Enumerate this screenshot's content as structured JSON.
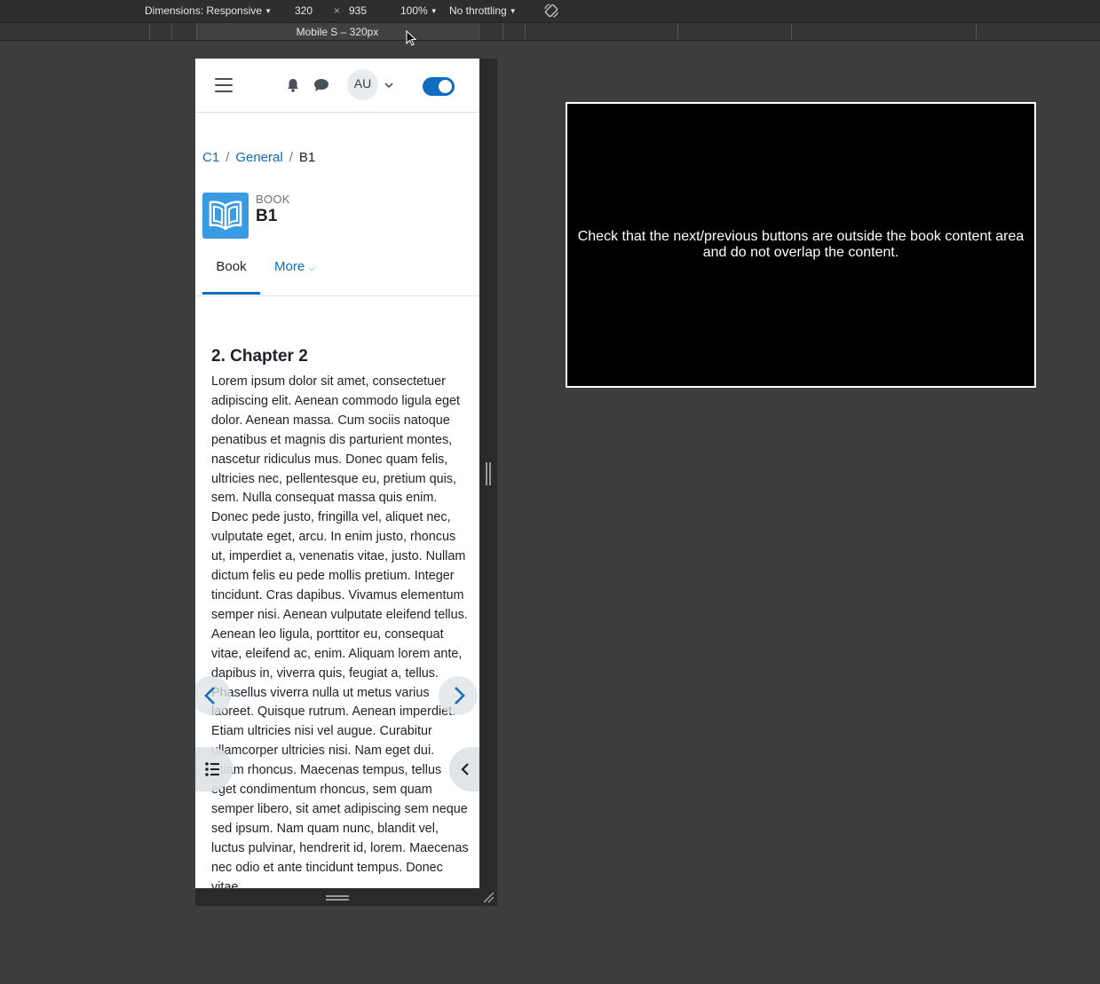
{
  "devtools": {
    "dimensions_label": "Dimensions: Responsive",
    "width": "320",
    "times": "×",
    "height": "935",
    "zoom": "100%",
    "throttling": "No throttling",
    "device_label": "Mobile S – 320px"
  },
  "navbar": {
    "avatar_initials": "AU",
    "edit_mode_on": true,
    "accent_color": "#0f6cbf"
  },
  "breadcrumb": {
    "items": [
      "C1",
      "General",
      "B1"
    ],
    "separator": "/"
  },
  "activity": {
    "kind": "BOOK",
    "title": "B1",
    "icon_color": "#399be2"
  },
  "tabs": {
    "book": "Book",
    "more": "More"
  },
  "chapter": {
    "title": "2. Chapter 2",
    "body": "Lorem ipsum dolor sit amet, consectetuer adipiscing elit. Aenean commodo ligula eget dolor. Aenean massa. Cum sociis natoque penatibus et magnis dis parturient montes, nascetur ridiculus mus. Donec quam felis, ultricies nec, pellentesque eu, pretium quis, sem. Nulla consequat massa quis enim. Donec pede justo, fringilla vel, aliquet nec, vulputate eget, arcu. In enim justo, rhoncus ut, imperdiet a, venenatis vitae, justo. Nullam dictum felis eu pede mollis pretium. Integer tincidunt. Cras dapibus. Vivamus elementum semper nisi. Aenean vulputate eleifend tellus. Aenean leo ligula, porttitor eu, consequat vitae, eleifend ac, enim. Aliquam lorem ante, dapibus in, viverra quis, feugiat a, tellus. Phasellus viverra nulla ut metus varius laoreet. Quisque rutrum. Aenean imperdiet. Etiam ultricies nisi vel augue. Curabitur ullamcorper ultricies nisi. Nam eget dui. Etiam rhoncus. Maecenas tempus, tellus eget condimentum rhoncus, sem quam semper libero, sit amet adipiscing sem neque sed ipsum. Nam quam nunc, blandit vel, luctus pulvinar, hendrerit id, lorem. Maecenas nec odio et ante tincidunt tempus. Donec vitae"
  },
  "overlay": {
    "message": "Check that the next/previous buttons are outside the book content area and do not overlap the content."
  }
}
